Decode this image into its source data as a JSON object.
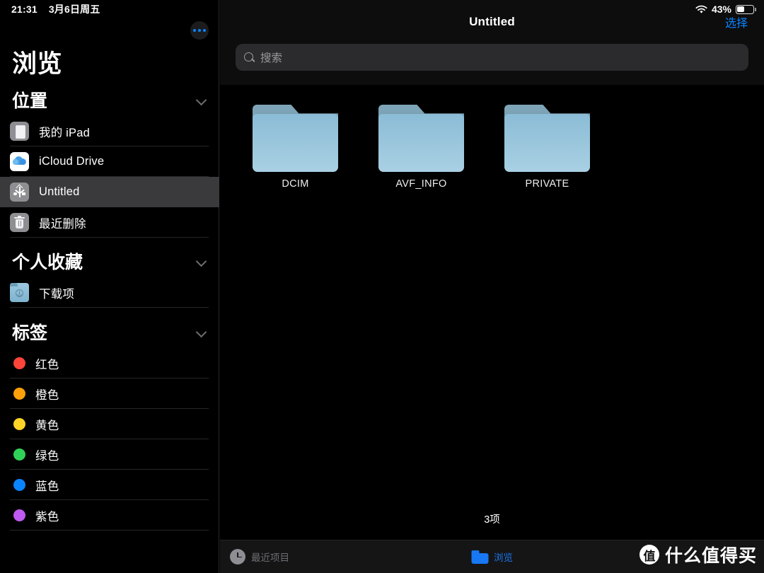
{
  "statusbar": {
    "time": "21:31",
    "date": "3月6日周五",
    "wifi_icon": "wifi-icon",
    "battery_percent": "43%",
    "battery_level": 43
  },
  "sidebar": {
    "title": "浏览",
    "more_button": "more-options",
    "sections": [
      {
        "name": "位置",
        "collapse_icon": "chevron-down-icon",
        "items": [
          {
            "label": "我的 iPad",
            "icon": "ipad-icon",
            "selected": false
          },
          {
            "label": "iCloud Drive",
            "icon": "icloud-icon",
            "selected": false
          },
          {
            "label": "Untitled",
            "icon": "usb-drive-icon",
            "selected": true
          },
          {
            "label": "最近删除",
            "icon": "trash-icon",
            "selected": false
          }
        ]
      },
      {
        "name": "个人收藏",
        "collapse_icon": "chevron-down-icon",
        "items": [
          {
            "label": "下载项",
            "icon": "downloads-folder-icon",
            "selected": false
          }
        ]
      },
      {
        "name": "标签",
        "collapse_icon": "chevron-down-icon",
        "items": [
          {
            "label": "红色",
            "icon": "tag-dot-icon",
            "color": "#ff453a"
          },
          {
            "label": "橙色",
            "icon": "tag-dot-icon",
            "color": "#ff9f0a"
          },
          {
            "label": "黄色",
            "icon": "tag-dot-icon",
            "color": "#ffd426"
          },
          {
            "label": "绿色",
            "icon": "tag-dot-icon",
            "color": "#30d158"
          },
          {
            "label": "蓝色",
            "icon": "tag-dot-icon",
            "color": "#0a84ff"
          },
          {
            "label": "紫色",
            "icon": "tag-dot-icon",
            "color": "#bf5af2"
          }
        ]
      }
    ]
  },
  "main": {
    "title": "Untitled",
    "select_label": "选择",
    "search": {
      "placeholder": "搜索",
      "value": "",
      "icon": "search-icon"
    },
    "items": [
      {
        "name": "DCIM",
        "icon": "folder-icon"
      },
      {
        "name": "AVF_INFO",
        "icon": "folder-icon"
      },
      {
        "name": "PRIVATE",
        "icon": "folder-icon"
      }
    ],
    "item_count_label": "3项"
  },
  "tabbar": {
    "tabs": [
      {
        "label": "最近项目",
        "icon": "clock-icon",
        "active": false
      },
      {
        "label": "浏览",
        "icon": "folder-icon",
        "active": true
      }
    ]
  },
  "watermark": {
    "badge": "值",
    "text": "什么值得买"
  },
  "colors": {
    "accent": "#0a84ff",
    "tab_active": "#1877f2",
    "selected_row": "#3a3a3c",
    "background": "#000000"
  }
}
